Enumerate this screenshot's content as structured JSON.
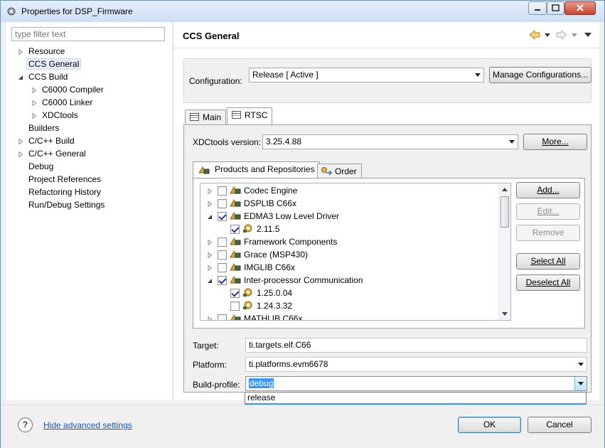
{
  "window": {
    "title": "Properties for DSP_Firmware"
  },
  "left_tree": {
    "filter_placeholder": "type filter text",
    "items": [
      {
        "label": "Resource",
        "level": 0,
        "expander": "collapsed"
      },
      {
        "label": "CCS General",
        "level": 0,
        "expander": "none",
        "selected": true
      },
      {
        "label": "CCS Build",
        "level": 0,
        "expander": "expanded"
      },
      {
        "label": "C6000 Compiler",
        "level": 1,
        "expander": "collapsed"
      },
      {
        "label": "C6000 Linker",
        "level": 1,
        "expander": "collapsed"
      },
      {
        "label": "XDCtools",
        "level": 1,
        "expander": "collapsed"
      },
      {
        "label": "Builders",
        "level": 0,
        "expander": "none"
      },
      {
        "label": "C/C++ Build",
        "level": 0,
        "expander": "collapsed"
      },
      {
        "label": "C/C++ General",
        "level": 0,
        "expander": "collapsed"
      },
      {
        "label": "Debug",
        "level": 0,
        "expander": "none"
      },
      {
        "label": "Project References",
        "level": 0,
        "expander": "none"
      },
      {
        "label": "Refactoring History",
        "level": 0,
        "expander": "none"
      },
      {
        "label": "Run/Debug Settings",
        "level": 0,
        "expander": "none"
      }
    ]
  },
  "page": {
    "title": "CCS General"
  },
  "configuration": {
    "label": "Configuration:",
    "value": "Release  [ Active ]",
    "manage_button": "Manage Configurations..."
  },
  "tabs": [
    {
      "label": "Main",
      "active": false
    },
    {
      "label": "RTSC",
      "active": true
    }
  ],
  "rtsc": {
    "xdc_label": "XDCtools version:",
    "xdc_value": "3.25.4.88",
    "more_button": "More...",
    "subtabs": [
      {
        "label": "Products and Repositories",
        "active": true
      },
      {
        "label": "Order",
        "active": false
      }
    ],
    "products": [
      {
        "label": "Codec Engine",
        "level": 0,
        "expander": "collapsed",
        "checked": false
      },
      {
        "label": "DSPLIB C66x",
        "level": 0,
        "expander": "collapsed",
        "checked": false
      },
      {
        "label": "EDMA3 Low Level Driver",
        "level": 0,
        "expander": "expanded",
        "checked": true
      },
      {
        "label": "2.11.5",
        "level": 1,
        "expander": "none",
        "checked": true
      },
      {
        "label": "Framework Components",
        "level": 0,
        "expander": "collapsed",
        "checked": false
      },
      {
        "label": "Grace (MSP430)",
        "level": 0,
        "expander": "collapsed",
        "checked": false
      },
      {
        "label": "IMGLIB C66x",
        "level": 0,
        "expander": "collapsed",
        "checked": false
      },
      {
        "label": "Inter-processor Communication",
        "level": 0,
        "expander": "expanded",
        "checked": true
      },
      {
        "label": "1.25.0.04",
        "level": 1,
        "expander": "none",
        "checked": true
      },
      {
        "label": "1.24.3.32",
        "level": 1,
        "expander": "none",
        "checked": false
      },
      {
        "label": "MATHLIB C66x",
        "level": 0,
        "expander": "collapsed",
        "checked": false
      }
    ],
    "buttons": {
      "add": "Add...",
      "edit": "Edit...",
      "remove": "Remove",
      "select_all": "Select All",
      "deselect_all": "Deselect All"
    },
    "target_label": "Target:",
    "target_value": "ti.targets.elf.C66",
    "platform_label": "Platform:",
    "platform_value": "ti.platforms.evm6678",
    "build_profile_label": "Build-profile:",
    "build_profile_value": "debug",
    "build_profile_options": [
      "release",
      "debug"
    ]
  },
  "footer": {
    "help_symbol": "?",
    "hide_advanced": "Hide advanced settings",
    "ok": "OK",
    "cancel": "Cancel"
  },
  "icons": {
    "window": "gear-icon",
    "nav_back": "back-arrow-icon",
    "nav_forward": "forward-arrow-icon",
    "view_menu": "view-menu-icon",
    "tab_main": "table-icon",
    "tab_rtsc": "table-icon",
    "products_tab": "package-icon",
    "order_tab": "order-icon",
    "product": "package-icon",
    "version": "gear-version-icon",
    "help": "help-icon"
  }
}
